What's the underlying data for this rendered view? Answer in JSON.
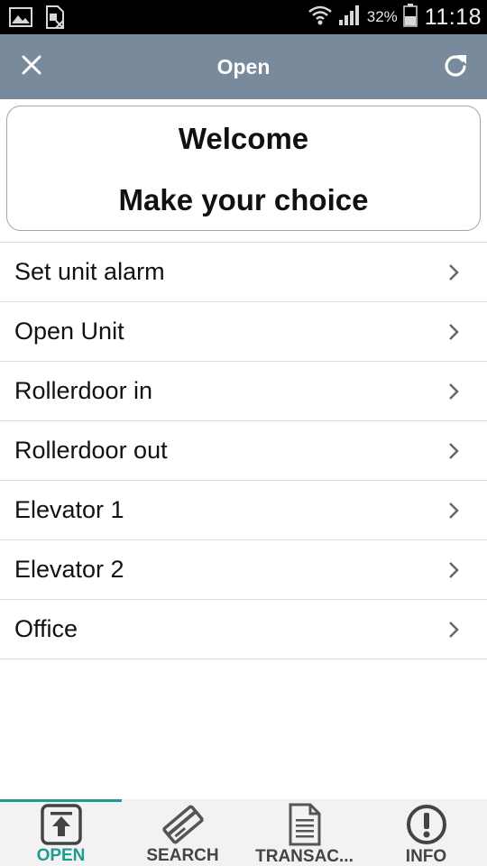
{
  "status_bar": {
    "battery_percent": "32%",
    "time": "11:18",
    "icons": [
      "image-notification-icon",
      "sim-notification-icon",
      "wifi-icon",
      "signal-icon",
      "battery-icon"
    ]
  },
  "app_bar": {
    "title": "Open",
    "close_icon": "close-icon",
    "refresh_icon": "refresh-icon",
    "background": "#798a9c"
  },
  "welcome": {
    "line1": "Welcome",
    "line2": "Make your choice"
  },
  "menu": {
    "items": [
      {
        "label": "Set unit alarm"
      },
      {
        "label": "Open Unit"
      },
      {
        "label": "Rollerdoor in"
      },
      {
        "label": "Rollerdoor out"
      },
      {
        "label": "Elevator 1"
      },
      {
        "label": "Elevator 2"
      },
      {
        "label": "Office"
      }
    ]
  },
  "tabs": {
    "accent": "#1f9a93",
    "items": [
      {
        "label": "OPEN",
        "icon": "upload-box-icon",
        "active": true
      },
      {
        "label": "SEARCH",
        "icon": "card-icon",
        "active": false
      },
      {
        "label": "TRANSAC...",
        "icon": "document-icon",
        "active": false
      },
      {
        "label": "INFO",
        "icon": "info-icon",
        "active": false
      }
    ]
  }
}
